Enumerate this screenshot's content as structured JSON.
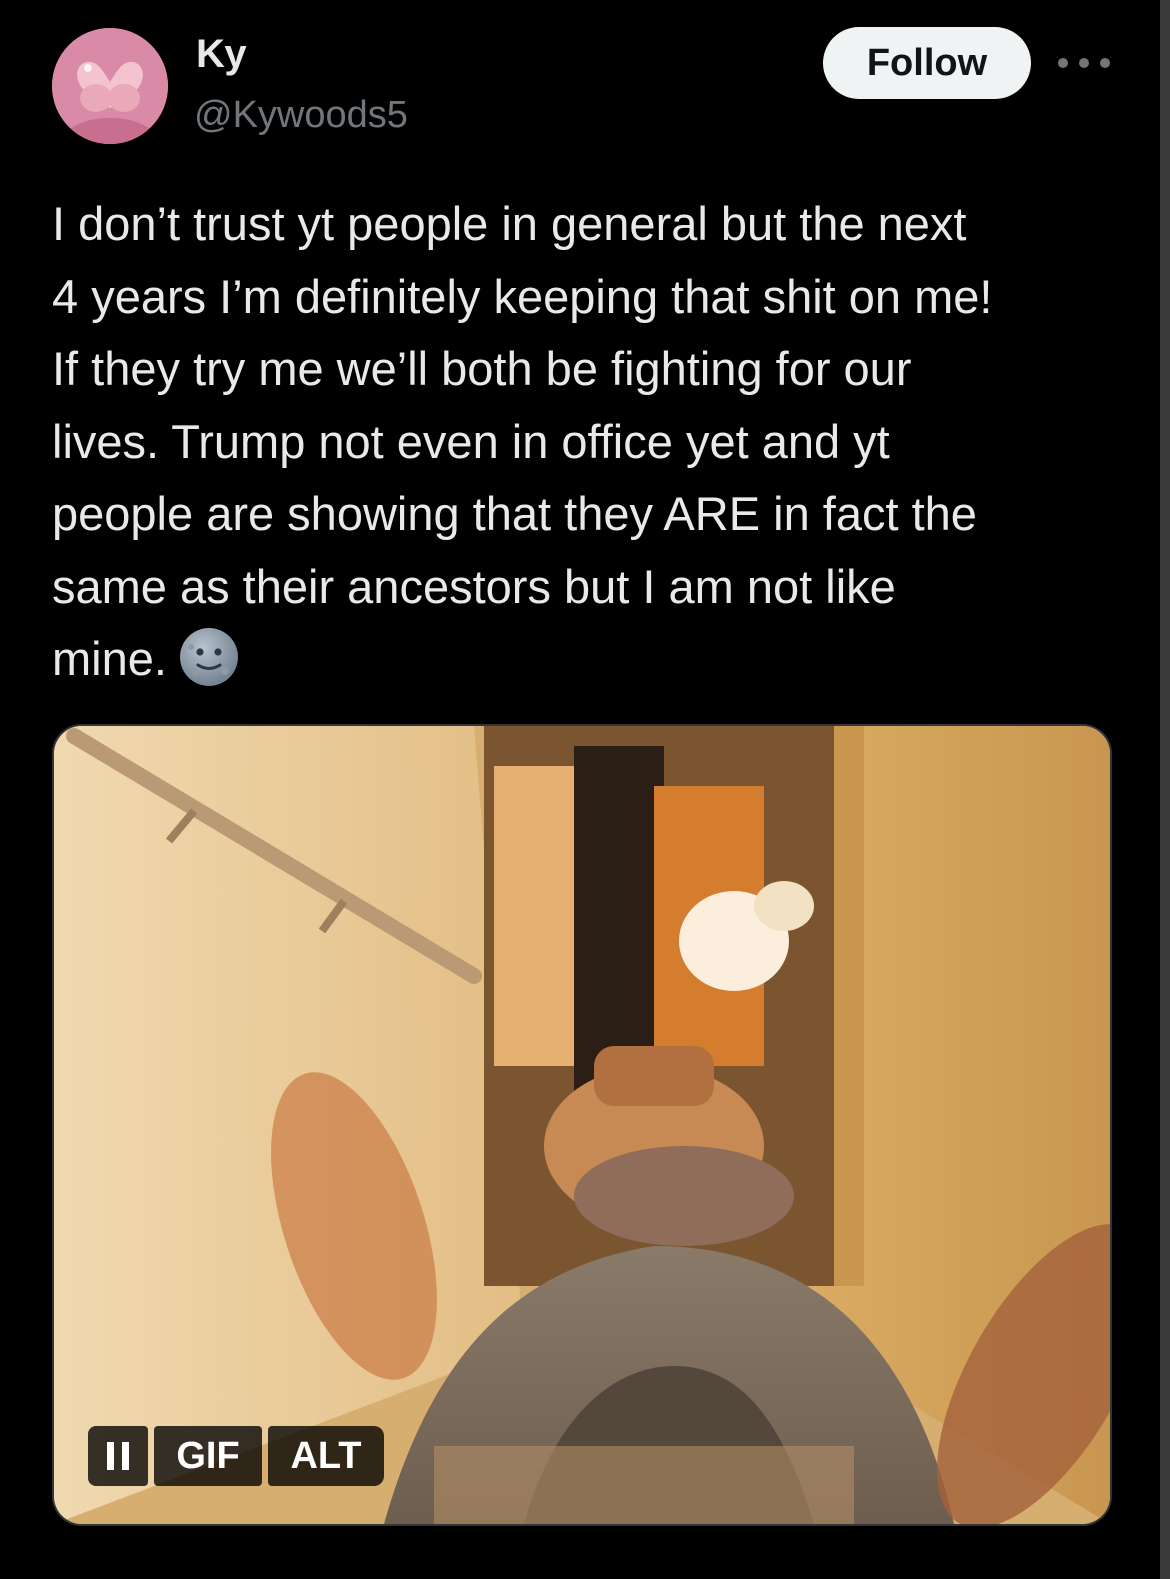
{
  "tweet": {
    "author": {
      "display_name": "Ky",
      "handle": "@Kywoods5"
    },
    "follow_label": "Follow",
    "text_lines": [
      "I don’t trust yt people in general but the next",
      "4 years I’m definitely keeping that shit on me!",
      "If they try me we’ll both be fighting for our",
      "lives. Trump not even in office yet and yt",
      "people are showing that they ARE in fact the",
      "same as their ancestors but I am not like",
      "mine."
    ],
    "emoji": "slightly-smiling-face-icon",
    "media": {
      "type": "gif",
      "controls": {
        "gif_label": "GIF",
        "alt_label": "ALT"
      }
    }
  },
  "colors": {
    "background": "#000000",
    "text_primary": "#e7e9ea",
    "text_secondary": "#71767b",
    "follow_bg": "#eff3f4",
    "follow_text": "#0f1419"
  }
}
